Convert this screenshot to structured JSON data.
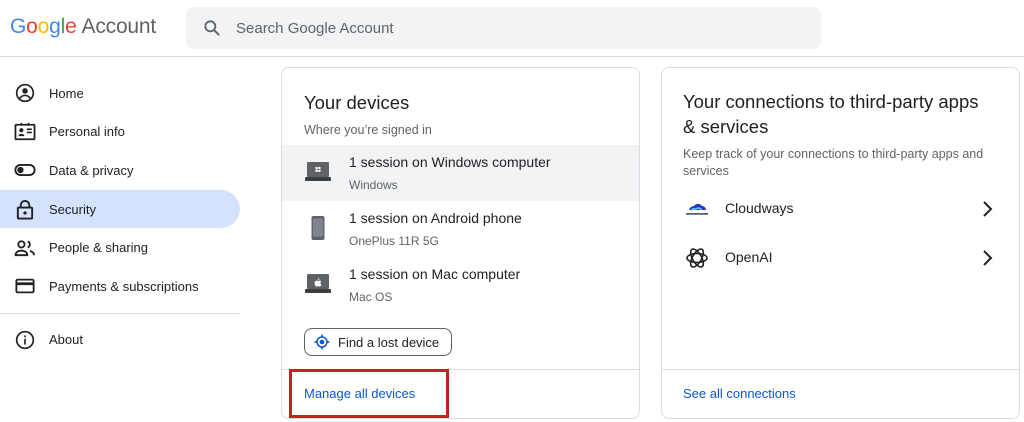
{
  "header": {
    "logo_letters": [
      "G",
      "o",
      "o",
      "g",
      "l",
      "e"
    ],
    "logo_colors": [
      "#4285f4",
      "#ea4335",
      "#fbbc05",
      "#4285f4",
      "#34a853",
      "#ea4335"
    ],
    "logo_suffix": "Account",
    "search_placeholder": "Search Google Account"
  },
  "sidebar": {
    "items": [
      {
        "label": "Home",
        "icon": "home-icon"
      },
      {
        "label": "Personal info",
        "icon": "personal-info-icon"
      },
      {
        "label": "Data & privacy",
        "icon": "toggle-icon"
      },
      {
        "label": "Security",
        "icon": "lock-icon",
        "active": true
      },
      {
        "label": "People & sharing",
        "icon": "people-icon"
      },
      {
        "label": "Payments & subscriptions",
        "icon": "credit-card-icon"
      }
    ],
    "about_label": "About",
    "active_color": "#d3e3fd"
  },
  "devices_card": {
    "title": "Your devices",
    "subtitle": "Where you’re signed in",
    "devices": [
      {
        "title": "1 session on Windows computer",
        "os": "Windows",
        "icon": "windows-laptop-icon"
      },
      {
        "title": "1 session on Android phone",
        "os": "OnePlus 11R 5G",
        "icon": "phone-icon"
      },
      {
        "title": "1 session on Mac computer",
        "os": "Mac OS",
        "icon": "mac-laptop-icon"
      }
    ],
    "find_button_label": "Find a lost device",
    "manage_link": "Manage all devices",
    "highlight_color": "#c5221f"
  },
  "connections_card": {
    "title": "Your connections to third-party apps & services",
    "subtitle": "Keep track of your connections to third-party apps and services",
    "items": [
      {
        "label": "Cloudways",
        "icon": "cloudways-icon"
      },
      {
        "label": "OpenAI",
        "icon": "openai-icon"
      }
    ],
    "see_all_link": "See all connections",
    "link_color": "#0b57d0"
  }
}
